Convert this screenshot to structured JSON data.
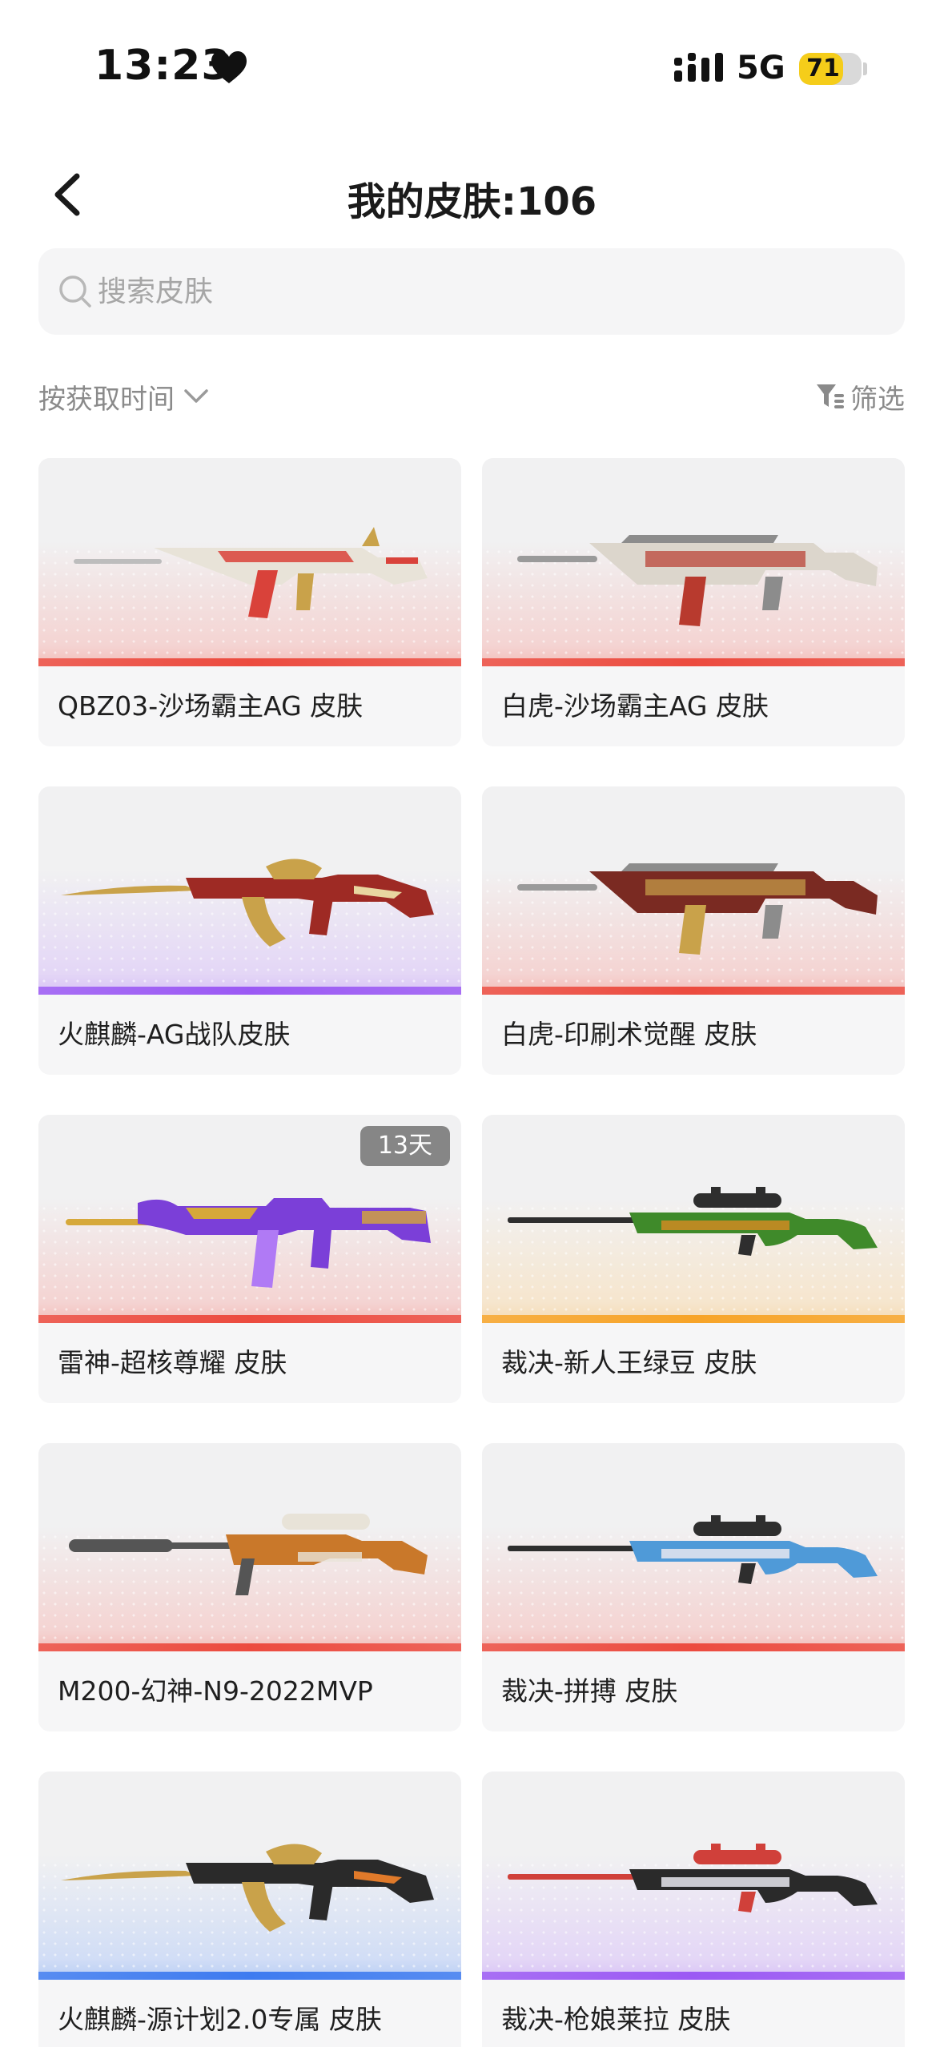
{
  "status_bar": {
    "time": "13:23",
    "network": "5G",
    "battery": "71",
    "battery_level": 0.71
  },
  "header": {
    "title": "我的皮肤:106"
  },
  "search": {
    "placeholder": "搜索皮肤"
  },
  "toolbar": {
    "sort_label": "按获取时间",
    "filter_label": "筛选"
  },
  "colors": {
    "red": "#ec4b3f",
    "purple": "#9b59f4",
    "orange": "#f7a428",
    "blue": "#3e7bf0",
    "badge": "#868686"
  },
  "skins": [
    {
      "name": "QBZ03-沙场霸主AG 皮肤",
      "rarity": "red",
      "weapon": "rifle",
      "palette": [
        "#e8e3d8",
        "#d9423a",
        "#c9a24a"
      ]
    },
    {
      "name": "白虎-沙场霸主AG 皮肤",
      "rarity": "red",
      "weapon": "smg",
      "palette": [
        "#dcd6cc",
        "#b83a2e",
        "#8c8c8c"
      ]
    },
    {
      "name": "火麒麟-AG战队皮肤",
      "rarity": "purple",
      "weapon": "ak",
      "palette": [
        "#9e2a24",
        "#c9a24a",
        "#e8d6a0"
      ]
    },
    {
      "name": "白虎-印刷术觉醒 皮肤",
      "rarity": "red",
      "weapon": "smg",
      "palette": [
        "#7a2a22",
        "#c9a24a",
        "#8c8c8c"
      ]
    },
    {
      "name": "雷神-超核尊耀 皮肤",
      "rarity": "red",
      "weapon": "m4",
      "palette": [
        "#7b3fd8",
        "#d6a83a",
        "#b07af5"
      ],
      "badge": "13天"
    },
    {
      "name": "裁决-新人王绿豆 皮肤",
      "rarity": "orange",
      "weapon": "sniper",
      "palette": [
        "#3f8a2a",
        "#d08a22",
        "#2e2e2e"
      ]
    },
    {
      "name": "M200-幻神-N9-2022MVP",
      "rarity": "red",
      "weapon": "sniper2",
      "palette": [
        "#c9782a",
        "#e8e3d8",
        "#555555"
      ]
    },
    {
      "name": "裁决-拼搏 皮肤",
      "rarity": "red",
      "weapon": "sniper",
      "palette": [
        "#4f9ad8",
        "#e8e8f0",
        "#2e2e2e"
      ]
    },
    {
      "name": "火麒麟-源计划2.0专属 皮肤",
      "rarity": "blue",
      "weapon": "ak",
      "palette": [
        "#2a2a2a",
        "#c9a24a",
        "#e07a2a"
      ]
    },
    {
      "name": "裁决-枪娘莱拉 皮肤",
      "rarity": "purple",
      "weapon": "sniper",
      "palette": [
        "#2a2a2a",
        "#e8e8ee",
        "#d0403a"
      ]
    }
  ]
}
